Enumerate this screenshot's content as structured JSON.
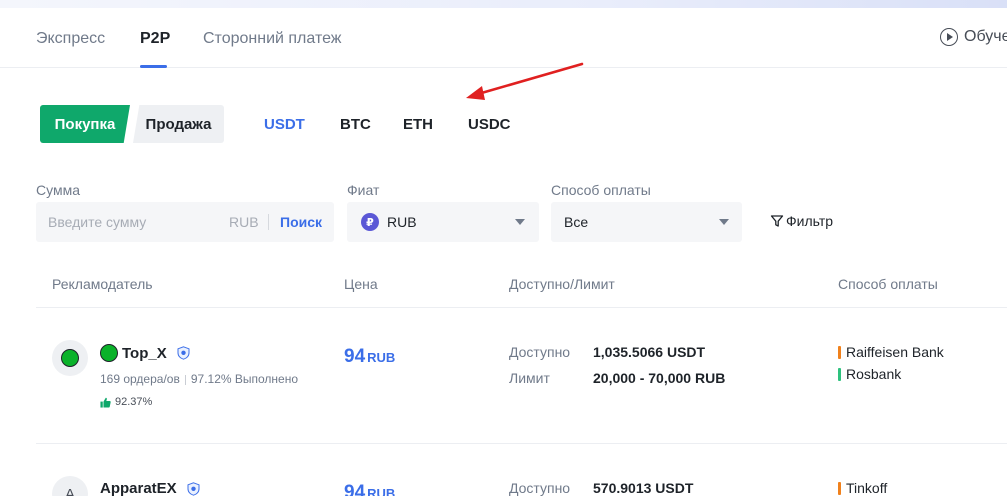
{
  "nav": {
    "tabs": [
      {
        "label": "Экспресс",
        "active": false
      },
      {
        "label": "P2P",
        "active": true
      },
      {
        "label": "Сторонний платеж",
        "active": false
      }
    ],
    "tutorial_label": "Обучение"
  },
  "trade": {
    "buy_label": "Покупка",
    "sell_label": "Продажа",
    "coins": [
      "USDT",
      "BTC",
      "ETH",
      "USDC"
    ],
    "active_coin": "USDT"
  },
  "filters": {
    "amount_label": "Сумма",
    "amount_placeholder": "Введите сумму",
    "amount_unit": "RUB",
    "search_label": "Поиск",
    "fiat_label": "Фиат",
    "fiat_symbol": "₽",
    "fiat_value": "RUB",
    "payment_label": "Способ оплаты",
    "payment_value": "Все",
    "filter_label": "Фильтр"
  },
  "table": {
    "headers": [
      "Рекламодатель",
      "Цена",
      "Доступно/Лимит",
      "Способ оплаты"
    ],
    "rows": [
      {
        "name": "Top_X",
        "avatar_letter": "",
        "orders": "169 ордера/ов",
        "completion": "97.12% Выполнено",
        "rating": "92.37%",
        "price": "94",
        "price_unit": "RUB",
        "available_label": "Доступно",
        "available": "1,035.5066 USDT",
        "limit_label": "Лимит",
        "limit": "20,000 - 70,000 RUB",
        "payments": [
          {
            "name": "Raiffeisen Bank",
            "color": "#f0811c"
          },
          {
            "name": "Rosbank",
            "color": "#2ec27e"
          }
        ]
      },
      {
        "name": "ApparatEX",
        "avatar_letter": "A",
        "price": "94",
        "price_unit": "RUB",
        "available_label": "Доступно",
        "available": "570.9013 USDT",
        "payments": [
          {
            "name": "Tinkoff",
            "color": "#f0811c"
          }
        ]
      }
    ]
  },
  "colors": {
    "accent_blue": "#3b6ee8",
    "buy_green": "#0fa86b",
    "arrow_red": "#e02020"
  }
}
